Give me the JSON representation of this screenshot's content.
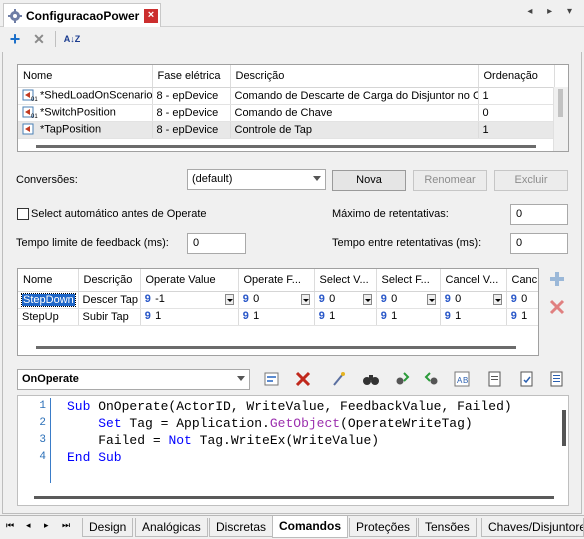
{
  "window": {
    "tab_title": "ConfiguracaoPower",
    "tab_icon": "gear-icon",
    "close_symbol": "×",
    "nav_arrows": "◂ ▸ ▾"
  },
  "toolbar": {
    "add_icon": "plus-icon",
    "remove_icon": "x-icon",
    "sort_icon": "sort-az-icon",
    "add_label": "+",
    "remove_label": "✕",
    "sort_label": "A↓Z"
  },
  "props_grid": {
    "columns": [
      "Nome",
      "Fase elétrica",
      "Descrição",
      "Ordenação"
    ],
    "rows": [
      {
        "nome": "*ShedLoadOnScenario",
        "fase": "8 - epDevice",
        "descricao": "Comando de Descarte de Carga do Disjuntor no Ce",
        "ordem": "1"
      },
      {
        "nome": "*SwitchPosition",
        "fase": "8 - epDevice",
        "descricao": "Comando de Chave",
        "ordem": "0"
      },
      {
        "nome": "*TapPosition",
        "fase": "8 - epDevice",
        "descricao": "Controle de Tap",
        "ordem": "1"
      }
    ]
  },
  "conversoes": {
    "label": "Conversões:",
    "selected": "(default)",
    "nova_label": "Nova",
    "renomear_label": "Renomear",
    "excluir_label": "Excluir"
  },
  "settings": {
    "auto_select_label": "Select automático antes de Operate",
    "auto_select_checked": false,
    "max_retries_label": "Máximo de retentativas:",
    "max_retries_value": "0",
    "feedback_timeout_label": "Tempo limite de feedback (ms):",
    "feedback_timeout_value": "0",
    "retry_interval_label": "Tempo entre retentativas (ms):",
    "retry_interval_value": "0"
  },
  "conv_grid": {
    "columns": [
      "Nome",
      "Descrição",
      "Operate Value",
      "Operate F...",
      "Select V...",
      "Select F...",
      "Cancel V...",
      "Canc"
    ],
    "rows": [
      {
        "nome": "StepDown",
        "descricao": "Descer Tap",
        "operate_value": "-1",
        "operate_f": "0",
        "select_v": "0",
        "select_f": "0",
        "cancel_v": "0",
        "canc": "0",
        "selected": true
      },
      {
        "nome": "StepUp",
        "descricao": "Subir Tap",
        "operate_value": "1",
        "operate_f": "1",
        "select_v": "1",
        "select_f": "1",
        "cancel_v": "1",
        "canc": "1",
        "selected": false
      }
    ],
    "cell_prefix": "9",
    "add_icon": "plus-icon",
    "delete_icon": "x-icon"
  },
  "script": {
    "event_selected": "OnOperate",
    "line_numbers": [
      "1",
      "2",
      "3",
      "4"
    ],
    "lines": [
      {
        "indent": "",
        "parts": [
          [
            "kw",
            "Sub"
          ],
          [
            "t",
            " OnOperate(ActorID, WriteValue, FeedbackValue, Failed)"
          ]
        ]
      },
      {
        "indent": "    ",
        "parts": [
          [
            "kw",
            "Set"
          ],
          [
            "t",
            " Tag = Application."
          ],
          [
            "fn",
            "GetObject"
          ],
          [
            "t",
            "(OperateWriteTag)"
          ]
        ]
      },
      {
        "indent": "    ",
        "parts": [
          [
            "t",
            "Failed = "
          ],
          [
            "kw",
            "Not"
          ],
          [
            "t",
            " Tag.WriteEx(WriteValue)"
          ]
        ]
      },
      {
        "indent": "",
        "parts": [
          [
            "kw",
            "End Sub"
          ]
        ]
      }
    ],
    "toolbar_icons": [
      "insert-tag-icon",
      "delete-red-x-icon",
      "wand-icon",
      "binoculars-icon",
      "find-prev-icon",
      "find-next-icon",
      "replace-icon",
      "page-icon",
      "page-check-icon",
      "page-list-icon"
    ]
  },
  "bottom_tabs": {
    "nav": [
      "⏮",
      "◂",
      "▸",
      "⏭"
    ],
    "tabs": [
      "Design",
      "Analógicas",
      "Discretas",
      "Comandos",
      "Proteções",
      "Tensões",
      "Chaves/Disjuntore"
    ],
    "active": "Comandos"
  }
}
